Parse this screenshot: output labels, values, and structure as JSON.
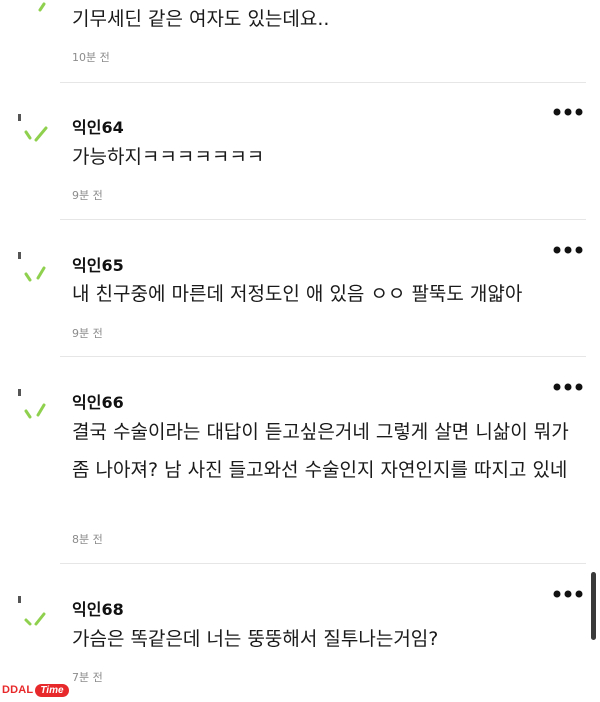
{
  "comments": [
    {
      "author": "",
      "text": "기무세딘 같은 여자도 있는데요..",
      "time": "10분 전"
    },
    {
      "author": "익인64",
      "text": "가능하지ㅋㅋㅋㅋㅋㅋㅋ",
      "time": "9분 전"
    },
    {
      "author": "익인65",
      "text": "내 친구중에 마른데 저정도인 애 있음 ㅇㅇ 팔뚝도 개얇아",
      "time": "9분 전"
    },
    {
      "author": "익인66",
      "text": "결국 수술이라는 대답이 듣고싶은거네 그렇게 살면 니삶이 뭐가 좀 나아져? 남 사진 들고와선 수술인지 자연인지를 따지고 있네",
      "time": "8분 전"
    },
    {
      "author": "익인68",
      "text": "가슴은 똑같은데 너는 뚱뚱해서 질투나는거임?",
      "time": "7분 전"
    }
  ],
  "icons": {
    "avatar": "anonymous-avatar-icon",
    "more": "more-options-icon"
  },
  "colors": {
    "avatar_green": "#8fd14f",
    "avatar_dark": "#555555",
    "time_text": "#8c8c8c",
    "divider": "#e6e6e6",
    "watermark_red": "#e8292b"
  },
  "watermark": {
    "brand": "DDAL",
    "badge": "Time"
  }
}
